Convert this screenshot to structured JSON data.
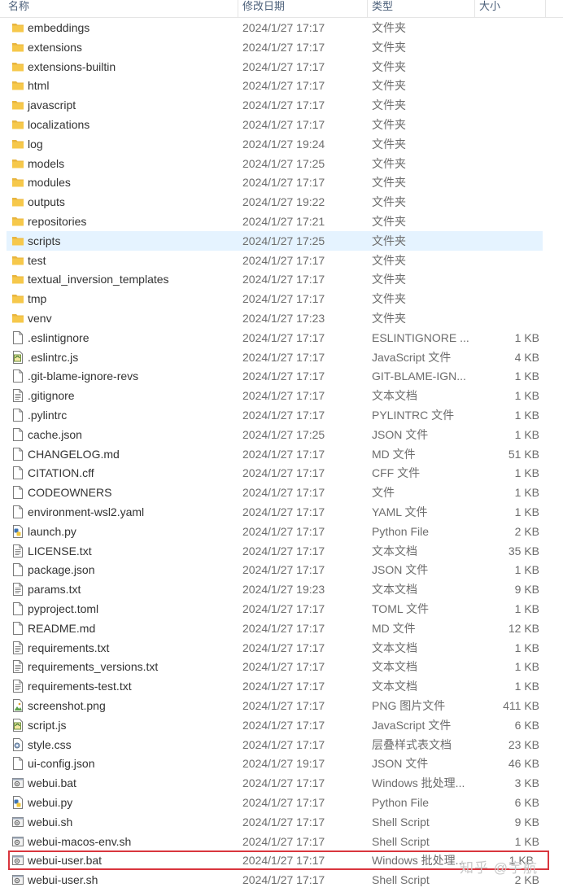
{
  "columns": {
    "name": "名称",
    "date": "修改日期",
    "type": "类型",
    "size": "大小"
  },
  "colors": {
    "selected_row": "#e5f3ff",
    "highlight_box": "#d9363e",
    "folder": "#e8b53f"
  },
  "files": [
    {
      "name": "embeddings",
      "date": "2024/1/27 17:17",
      "type": "文件夹",
      "size": "",
      "icon": "folder-icon"
    },
    {
      "name": "extensions",
      "date": "2024/1/27 17:17",
      "type": "文件夹",
      "size": "",
      "icon": "folder-icon"
    },
    {
      "name": "extensions-builtin",
      "date": "2024/1/27 17:17",
      "type": "文件夹",
      "size": "",
      "icon": "folder-icon"
    },
    {
      "name": "html",
      "date": "2024/1/27 17:17",
      "type": "文件夹",
      "size": "",
      "icon": "folder-icon"
    },
    {
      "name": "javascript",
      "date": "2024/1/27 17:17",
      "type": "文件夹",
      "size": "",
      "icon": "folder-icon"
    },
    {
      "name": "localizations",
      "date": "2024/1/27 17:17",
      "type": "文件夹",
      "size": "",
      "icon": "folder-icon"
    },
    {
      "name": "log",
      "date": "2024/1/27 19:24",
      "type": "文件夹",
      "size": "",
      "icon": "folder-icon"
    },
    {
      "name": "models",
      "date": "2024/1/27 17:25",
      "type": "文件夹",
      "size": "",
      "icon": "folder-icon"
    },
    {
      "name": "modules",
      "date": "2024/1/27 17:17",
      "type": "文件夹",
      "size": "",
      "icon": "folder-icon"
    },
    {
      "name": "outputs",
      "date": "2024/1/27 19:22",
      "type": "文件夹",
      "size": "",
      "icon": "folder-icon"
    },
    {
      "name": "repositories",
      "date": "2024/1/27 17:21",
      "type": "文件夹",
      "size": "",
      "icon": "folder-icon"
    },
    {
      "name": "scripts",
      "date": "2024/1/27 17:25",
      "type": "文件夹",
      "size": "",
      "icon": "folder-icon",
      "selected": true
    },
    {
      "name": "test",
      "date": "2024/1/27 17:17",
      "type": "文件夹",
      "size": "",
      "icon": "folder-icon"
    },
    {
      "name": "textual_inversion_templates",
      "date": "2024/1/27 17:17",
      "type": "文件夹",
      "size": "",
      "icon": "folder-icon"
    },
    {
      "name": "tmp",
      "date": "2024/1/27 17:17",
      "type": "文件夹",
      "size": "",
      "icon": "folder-icon"
    },
    {
      "name": "venv",
      "date": "2024/1/27 17:23",
      "type": "文件夹",
      "size": "",
      "icon": "folder-icon"
    },
    {
      "name": ".eslintignore",
      "date": "2024/1/27 17:17",
      "type": "ESLINTIGNORE ...",
      "size": "1 KB",
      "icon": "blank-file-icon"
    },
    {
      "name": ".eslintrc.js",
      "date": "2024/1/27 17:17",
      "type": "JavaScript 文件",
      "size": "4 KB",
      "icon": "script-file-icon"
    },
    {
      "name": ".git-blame-ignore-revs",
      "date": "2024/1/27 17:17",
      "type": "GIT-BLAME-IGN...",
      "size": "1 KB",
      "icon": "blank-file-icon"
    },
    {
      "name": ".gitignore",
      "date": "2024/1/27 17:17",
      "type": "文本文档",
      "size": "1 KB",
      "icon": "text-file-icon"
    },
    {
      "name": ".pylintrc",
      "date": "2024/1/27 17:17",
      "type": "PYLINTRC 文件",
      "size": "1 KB",
      "icon": "blank-file-icon"
    },
    {
      "name": "cache.json",
      "date": "2024/1/27 17:25",
      "type": "JSON 文件",
      "size": "1 KB",
      "icon": "blank-file-icon"
    },
    {
      "name": "CHANGELOG.md",
      "date": "2024/1/27 17:17",
      "type": "MD 文件",
      "size": "51 KB",
      "icon": "blank-file-icon"
    },
    {
      "name": "CITATION.cff",
      "date": "2024/1/27 17:17",
      "type": "CFF 文件",
      "size": "1 KB",
      "icon": "blank-file-icon"
    },
    {
      "name": "CODEOWNERS",
      "date": "2024/1/27 17:17",
      "type": "文件",
      "size": "1 KB",
      "icon": "blank-file-icon"
    },
    {
      "name": "environment-wsl2.yaml",
      "date": "2024/1/27 17:17",
      "type": "YAML 文件",
      "size": "1 KB",
      "icon": "blank-file-icon"
    },
    {
      "name": "launch.py",
      "date": "2024/1/27 17:17",
      "type": "Python File",
      "size": "2 KB",
      "icon": "python-file-icon"
    },
    {
      "name": "LICENSE.txt",
      "date": "2024/1/27 17:17",
      "type": "文本文档",
      "size": "35 KB",
      "icon": "text-file-icon"
    },
    {
      "name": "package.json",
      "date": "2024/1/27 17:17",
      "type": "JSON 文件",
      "size": "1 KB",
      "icon": "blank-file-icon"
    },
    {
      "name": "params.txt",
      "date": "2024/1/27 19:23",
      "type": "文本文档",
      "size": "9 KB",
      "icon": "text-file-icon"
    },
    {
      "name": "pyproject.toml",
      "date": "2024/1/27 17:17",
      "type": "TOML 文件",
      "size": "1 KB",
      "icon": "blank-file-icon"
    },
    {
      "name": "README.md",
      "date": "2024/1/27 17:17",
      "type": "MD 文件",
      "size": "12 KB",
      "icon": "blank-file-icon"
    },
    {
      "name": "requirements.txt",
      "date": "2024/1/27 17:17",
      "type": "文本文档",
      "size": "1 KB",
      "icon": "text-file-icon"
    },
    {
      "name": "requirements_versions.txt",
      "date": "2024/1/27 17:17",
      "type": "文本文档",
      "size": "1 KB",
      "icon": "text-file-icon"
    },
    {
      "name": "requirements-test.txt",
      "date": "2024/1/27 17:17",
      "type": "文本文档",
      "size": "1 KB",
      "icon": "text-file-icon"
    },
    {
      "name": "screenshot.png",
      "date": "2024/1/27 17:17",
      "type": "PNG 图片文件",
      "size": "411 KB",
      "icon": "image-file-icon"
    },
    {
      "name": "script.js",
      "date": "2024/1/27 17:17",
      "type": "JavaScript 文件",
      "size": "6 KB",
      "icon": "script-file-icon"
    },
    {
      "name": "style.css",
      "date": "2024/1/27 17:17",
      "type": "层叠样式表文档",
      "size": "23 KB",
      "icon": "css-file-icon"
    },
    {
      "name": "ui-config.json",
      "date": "2024/1/27 19:17",
      "type": "JSON 文件",
      "size": "46 KB",
      "icon": "blank-file-icon"
    },
    {
      "name": "webui.bat",
      "date": "2024/1/27 17:17",
      "type": "Windows 批处理...",
      "size": "3 KB",
      "icon": "batch-file-icon"
    },
    {
      "name": "webui.py",
      "date": "2024/1/27 17:17",
      "type": "Python File",
      "size": "6 KB",
      "icon": "python-file-icon"
    },
    {
      "name": "webui.sh",
      "date": "2024/1/27 17:17",
      "type": "Shell Script",
      "size": "9 KB",
      "icon": "batch-file-icon"
    },
    {
      "name": "webui-macos-env.sh",
      "date": "2024/1/27 17:17",
      "type": "Shell Script",
      "size": "1 KB",
      "icon": "batch-file-icon"
    },
    {
      "name": "webui-user.bat",
      "date": "2024/1/27 17:17",
      "type": "Windows 批处理...",
      "size": "1 KB",
      "icon": "batch-file-icon",
      "highlighted": true
    },
    {
      "name": "webui-user.sh",
      "date": "2024/1/27 17:17",
      "type": "Shell Script",
      "size": "2 KB",
      "icon": "batch-file-icon"
    }
  ],
  "watermark": "知乎 @宇航"
}
